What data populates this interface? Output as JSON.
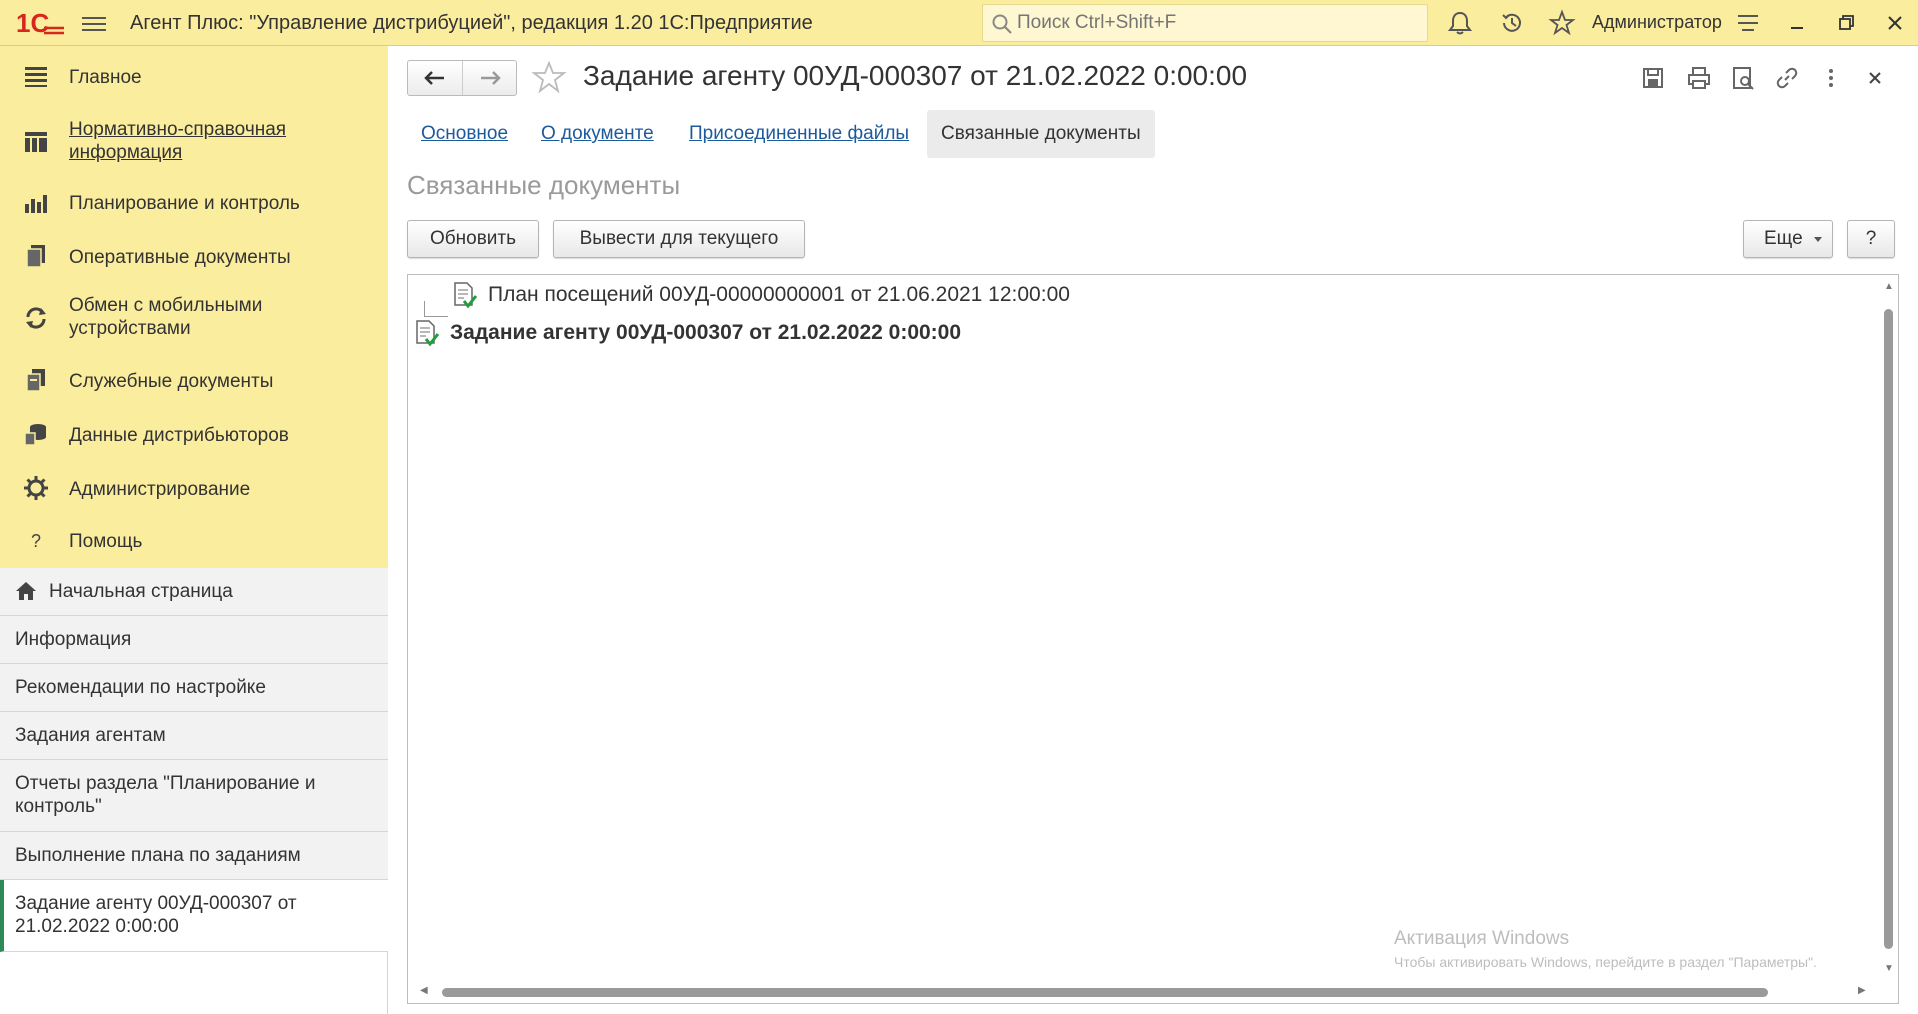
{
  "titlebar": {
    "logo_text": "1С",
    "app_title": "Агент Плюс: \"Управление дистрибуцией\", редакция 1.20 1С:Предприятие",
    "search_placeholder": "Поиск Ctrl+Shift+F",
    "user": "Администратор"
  },
  "sidebar": {
    "sections": [
      {
        "label": "Главное",
        "icon": "menu-list-icon"
      },
      {
        "label": "Нормативно-справочная информация",
        "icon": "reference-grid-icon"
      },
      {
        "label": "Планирование и контроль",
        "icon": "bar-chart-icon"
      },
      {
        "label": "Оперативные документы",
        "icon": "documents-icon"
      },
      {
        "label": "Обмен с мобильными устройствами",
        "icon": "sync-icon"
      },
      {
        "label": "Служебные документы",
        "icon": "service-docs-icon"
      },
      {
        "label": "Данные дистрибьюторов",
        "icon": "distributor-data-icon"
      },
      {
        "label": "Администрирование",
        "icon": "gear-icon"
      },
      {
        "label": "Помощь",
        "icon": "help-icon"
      }
    ],
    "open_items": [
      "Начальная страница",
      "Информация",
      "Рекомендации по настройке",
      "Задания агентам",
      "Отчеты раздела \"Планирование и контроль\"",
      "Выполнение плана по заданиям",
      "Задание агенту 00УД-000307 от 21.02.2022 0:00:00"
    ]
  },
  "main": {
    "title": "Задание агенту 00УД-000307 от 21.02.2022 0:00:00",
    "tabs": [
      "Основное",
      "О документе",
      "Присоединенные файлы",
      "Связанные документы"
    ],
    "section_title": "Связанные документы",
    "buttons": {
      "refresh": "Обновить",
      "show_current": "Вывести для текущего",
      "more": "Еще",
      "help": "?"
    },
    "tree": [
      "План посещений 00УД-00000000001 от 21.06.2021 12:00:00",
      "Задание агенту 00УД-000307 от 21.02.2022 0:00:00"
    ]
  },
  "watermark": {
    "line1": "Активация Windows",
    "line2": "Чтобы активировать Windows, перейдите в раздел \"Параметры\"."
  }
}
